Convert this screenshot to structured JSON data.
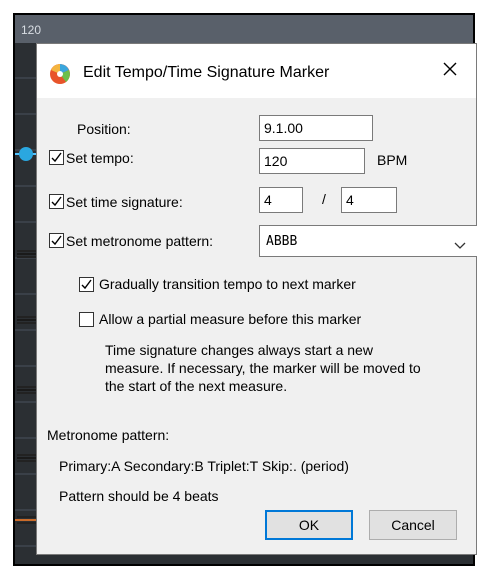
{
  "background": {
    "ruler_label": "120"
  },
  "dialog": {
    "title": "Edit Tempo/Time Signature Marker",
    "icon": "reaper-app-icon",
    "close_icon": "close-x-icon",
    "position": {
      "label": "Position:",
      "value": "9.1.00"
    },
    "set_tempo": {
      "label": "Set tempo:",
      "checked": true,
      "value": "120",
      "unit": "BPM"
    },
    "set_time_signature": {
      "label": "Set time signature:",
      "checked": true,
      "numerator": "4",
      "separator": "/",
      "denominator": "4"
    },
    "set_metronome_pattern": {
      "label": "Set metronome pattern:",
      "checked": true,
      "value": "ABBB"
    },
    "gradual_transition": {
      "label": "Gradually transition tempo to next marker",
      "checked": true
    },
    "partial_measure": {
      "label": "Allow a partial measure before this marker",
      "checked": false
    },
    "note_lines": [
      "Time signature changes always start a new",
      "measure. If necessary, the marker will be moved to",
      "the start of the next measure."
    ],
    "metronome_section_label": "Metronome pattern:",
    "pattern_legend": "Primary:A Secondary:B Triplet:T Skip:. (period)",
    "pattern_hint": "Pattern should be 4 beats",
    "ok_label": "OK",
    "cancel_label": "Cancel"
  },
  "colors": {
    "accent": "#0078d7",
    "tempo_marker": "#2aa7e0",
    "dialog_bg": "#f0f0f0"
  }
}
